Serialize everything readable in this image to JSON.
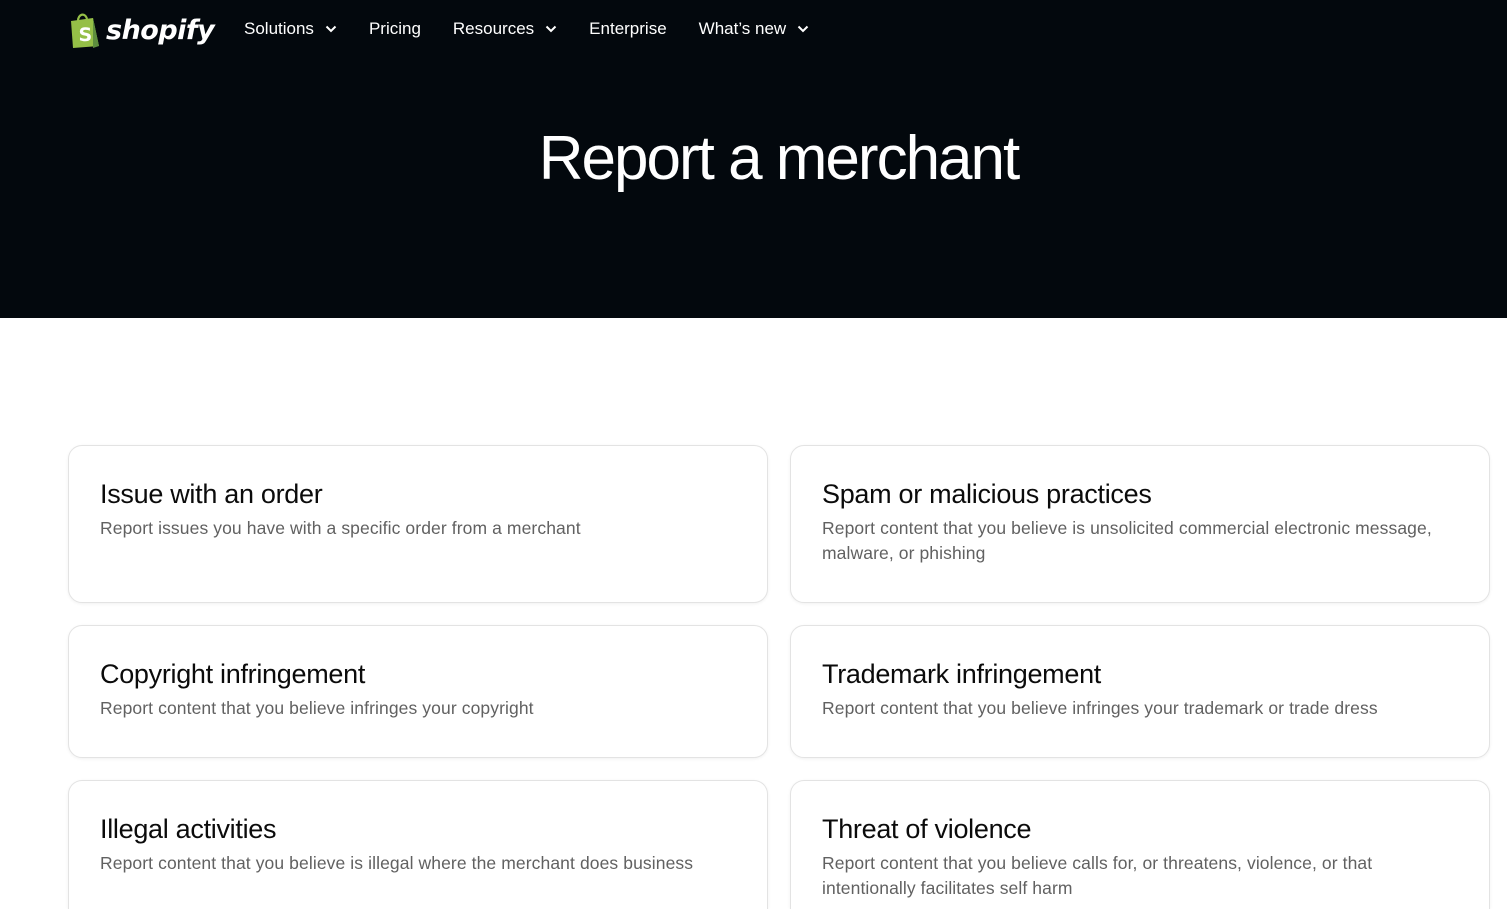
{
  "brand": {
    "name": "shopify",
    "accent": "#95bf47"
  },
  "nav": {
    "items": [
      {
        "label": "Solutions",
        "dropdown": true
      },
      {
        "label": "Pricing",
        "dropdown": false
      },
      {
        "label": "Resources",
        "dropdown": true
      },
      {
        "label": "Enterprise",
        "dropdown": false
      },
      {
        "label": "What’s new",
        "dropdown": true
      }
    ]
  },
  "hero": {
    "title": "Report a merchant",
    "background": "#03080d"
  },
  "cards": [
    {
      "title": "Issue with an order",
      "description": "Report issues you have with a specific order from a merchant"
    },
    {
      "title": "Spam or malicious practices",
      "description": "Report content that you believe is unsolicited commercial electronic message, malware, or phishing"
    },
    {
      "title": "Copyright infringement",
      "description": "Report content that you believe infringes your copyright"
    },
    {
      "title": "Trademark infringement",
      "description": "Report content that you believe infringes your trademark or trade dress"
    },
    {
      "title": "Illegal activities",
      "description": "Report content that you believe is illegal where the merchant does business"
    },
    {
      "title": "Threat of violence",
      "description": "Report content that you believe calls for, or threatens, violence, or that intentionally facilitates self harm"
    }
  ]
}
